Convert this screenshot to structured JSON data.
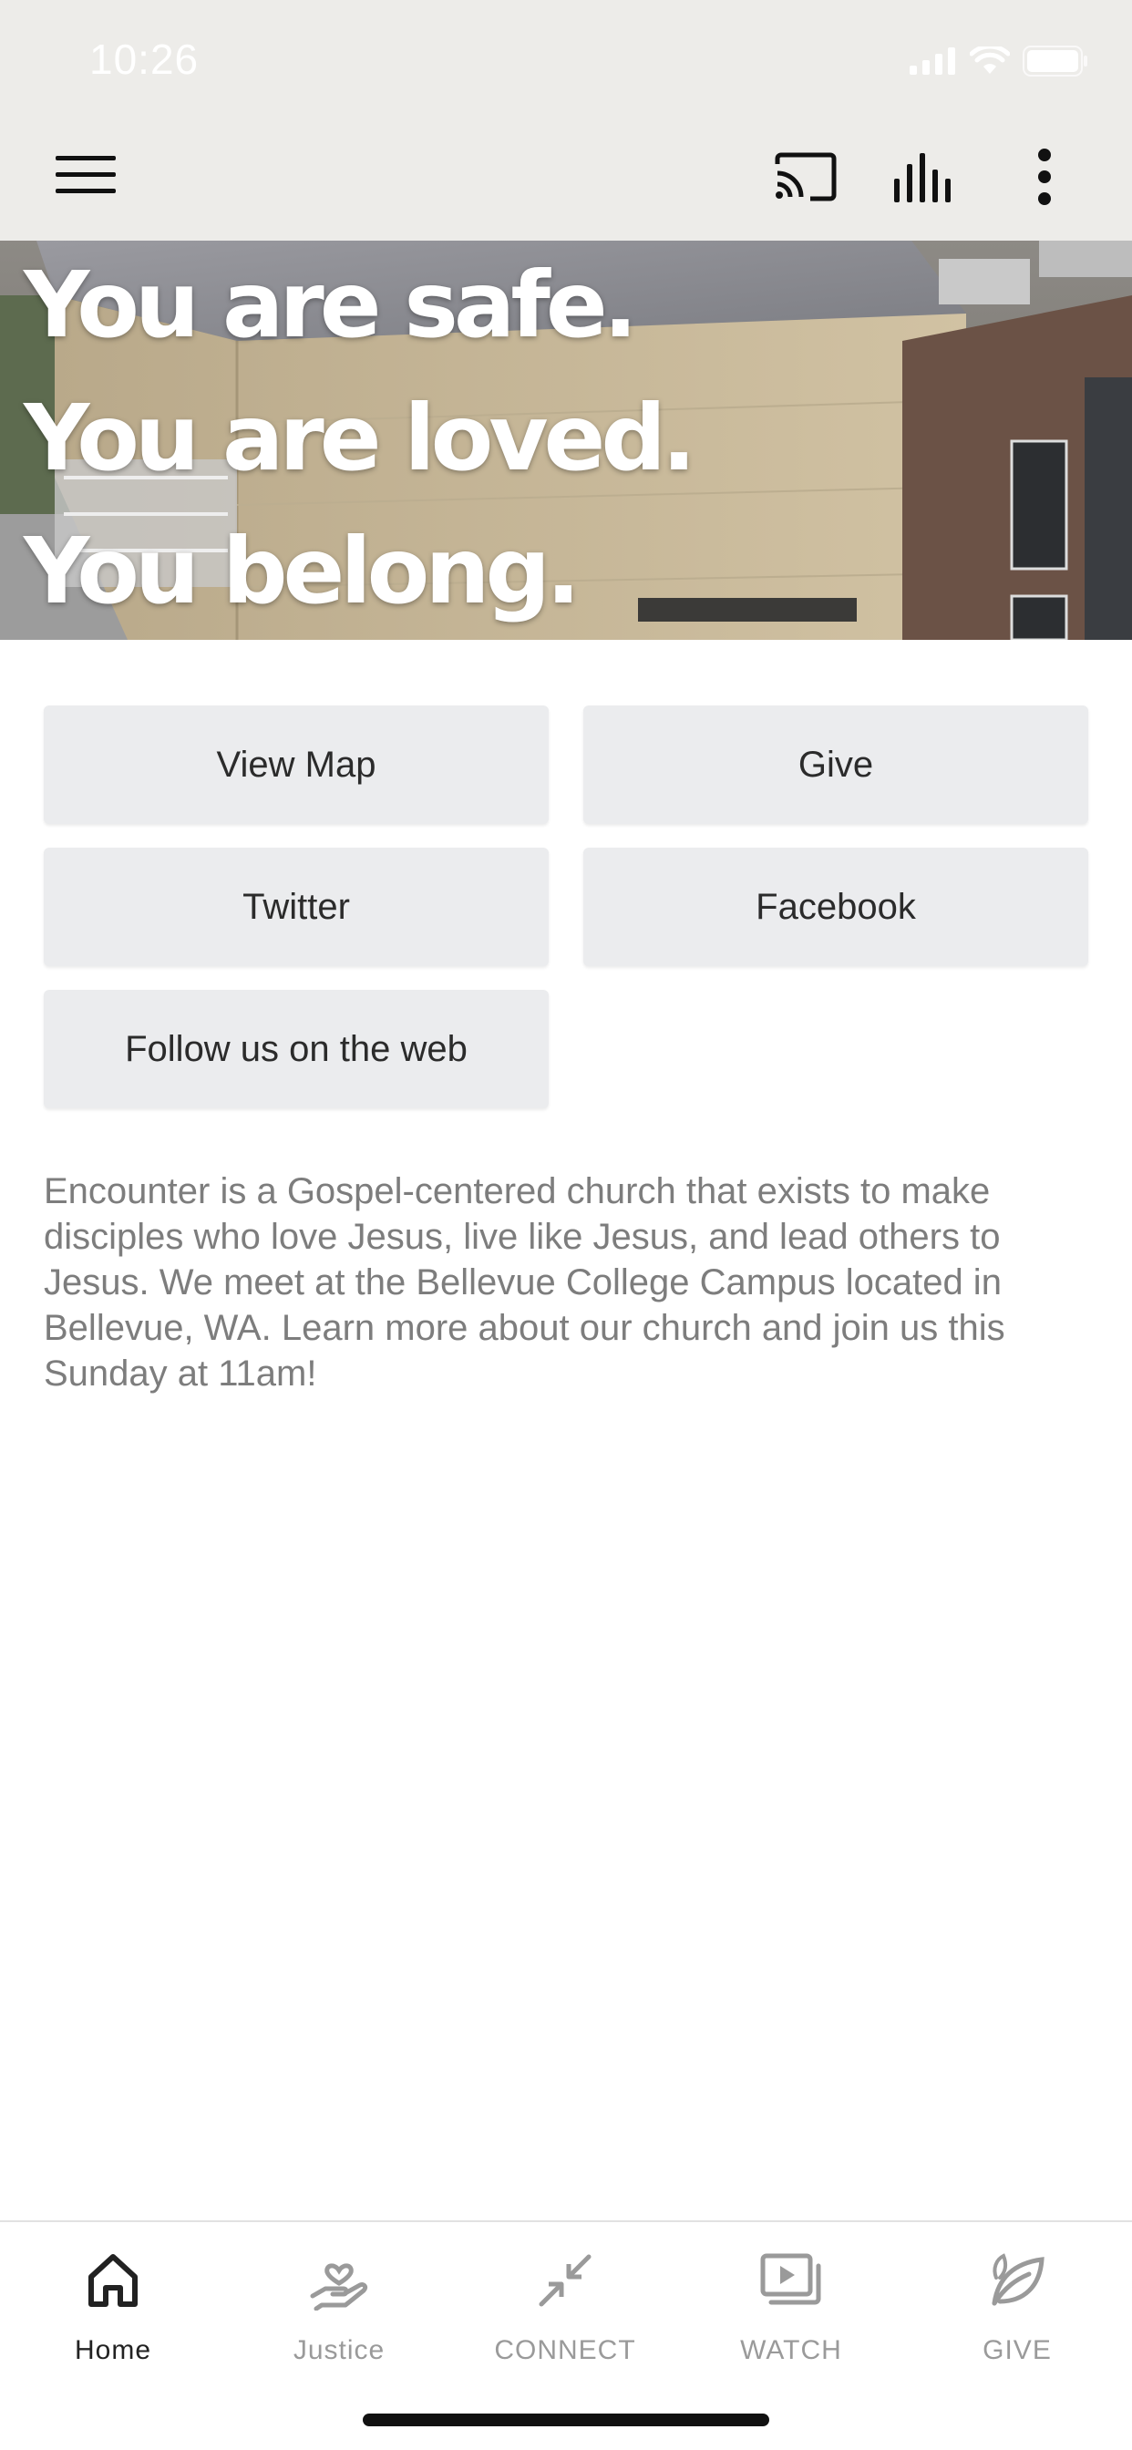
{
  "status_bar": {
    "time": "10:26"
  },
  "app_bar": {
    "menu_icon": "hamburger-menu-icon",
    "cast_icon": "cast-icon",
    "audio_icon": "audio-bars-icon",
    "more_icon": "more-vertical-icon"
  },
  "hero": {
    "lines": [
      "You are safe.",
      "You are loved.",
      "You belong."
    ]
  },
  "buttons": {
    "view_map": "View Map",
    "give": "Give",
    "twitter": "Twitter",
    "facebook": "Facebook",
    "web": "Follow us on the web"
  },
  "description": "Encounter is a Gospel-centered church that exists to make disciples who love Jesus, live like Jesus, and lead others to Jesus. We meet at the Bellevue College Campus located in Bellevue, WA. Learn more about our church and join us this Sunday at 11am!",
  "tabs": [
    {
      "label": "Home",
      "icon": "home-icon",
      "active": true
    },
    {
      "label": "Justice",
      "icon": "hand-heart-icon",
      "active": false
    },
    {
      "label": "CONNECT",
      "icon": "arrows-inward-icon",
      "active": false
    },
    {
      "label": "WATCH",
      "icon": "video-play-icon",
      "active": false
    },
    {
      "label": "GIVE",
      "icon": "leaf-icon",
      "active": false
    }
  ],
  "colors": {
    "topbar_bg": "#edece9",
    "button_bg": "#ebecee",
    "text_muted": "#7d7d7d",
    "tab_inactive": "#9a9a9a"
  }
}
